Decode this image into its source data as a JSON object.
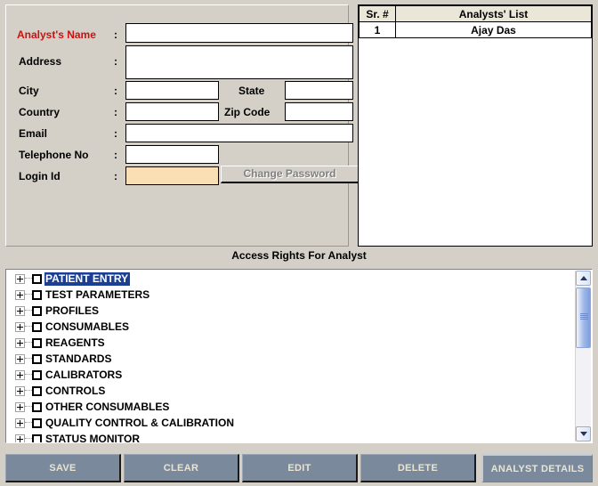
{
  "form": {
    "fields": [
      {
        "label": "Analyst's Name",
        "colon": ":",
        "value": "",
        "placeholder": "",
        "required": true
      },
      {
        "label": "Address",
        "colon": ":",
        "value": "",
        "placeholder": "",
        "required": false
      },
      {
        "label": "City",
        "colon": ":",
        "value": "",
        "placeholder": "",
        "required": false
      },
      {
        "label": "State",
        "colon": "",
        "value": "",
        "placeholder": "",
        "required": false
      },
      {
        "label": "Country",
        "colon": ":",
        "value": "",
        "placeholder": "",
        "required": false
      },
      {
        "label": "Zip Code",
        "colon": "",
        "value": "",
        "placeholder": "",
        "required": false
      },
      {
        "label": "Email",
        "colon": ":",
        "value": "",
        "placeholder": "",
        "required": false
      },
      {
        "label": "Telephone No",
        "colon": ":",
        "value": "",
        "placeholder": "",
        "required": false
      },
      {
        "label": "Login Id",
        "colon": ":",
        "value": "",
        "placeholder": "",
        "required": false
      }
    ],
    "change_password_label": "Change Password",
    "required_label_color": "#cc1111",
    "login_id_field_color": "#fbdfb4"
  },
  "analyst_list": {
    "columns": [
      "Sr. #",
      "Analysts'  List"
    ],
    "rows": [
      {
        "sr": "1",
        "name": "Ajay Das"
      }
    ],
    "header_bg": "#eae6d8"
  },
  "access_rights": {
    "caption": "Access Rights For Analyst",
    "selected_item": "PATIENT ENTRY",
    "selection_color": "#1c3f94",
    "items": [
      {
        "label": "PATIENT ENTRY",
        "checked": false,
        "expanded": false,
        "selected": true
      },
      {
        "label": "TEST PARAMETERS",
        "checked": false,
        "expanded": false,
        "selected": false
      },
      {
        "label": "PROFILES",
        "checked": false,
        "expanded": false,
        "selected": false
      },
      {
        "label": "CONSUMABLES",
        "checked": false,
        "expanded": false,
        "selected": false
      },
      {
        "label": "REAGENTS",
        "checked": false,
        "expanded": false,
        "selected": false
      },
      {
        "label": "STANDARDS",
        "checked": false,
        "expanded": false,
        "selected": false
      },
      {
        "label": "CALIBRATORS",
        "checked": false,
        "expanded": false,
        "selected": false
      },
      {
        "label": "CONTROLS",
        "checked": false,
        "expanded": false,
        "selected": false
      },
      {
        "label": "OTHER CONSUMABLES",
        "checked": false,
        "expanded": false,
        "selected": false
      },
      {
        "label": "QUALITY CONTROL & CALIBRATION",
        "checked": false,
        "expanded": false,
        "selected": false
      },
      {
        "label": "STATUS MONITOR",
        "checked": false,
        "expanded": false,
        "selected": false
      }
    ],
    "scrollbar": {
      "up_icon": "chevron-up-icon",
      "down_icon": "chevron-down-icon"
    }
  },
  "toolbar": {
    "button_bg": "#7a8a9c",
    "button_text_color": "#e9e4d2",
    "buttons": [
      {
        "label": "SAVE",
        "active": false
      },
      {
        "label": "CLEAR",
        "active": false
      },
      {
        "label": "EDIT",
        "active": false
      },
      {
        "label": "DELETE",
        "active": false
      },
      {
        "label": "ANALYST DETAILS",
        "active": true
      }
    ]
  }
}
